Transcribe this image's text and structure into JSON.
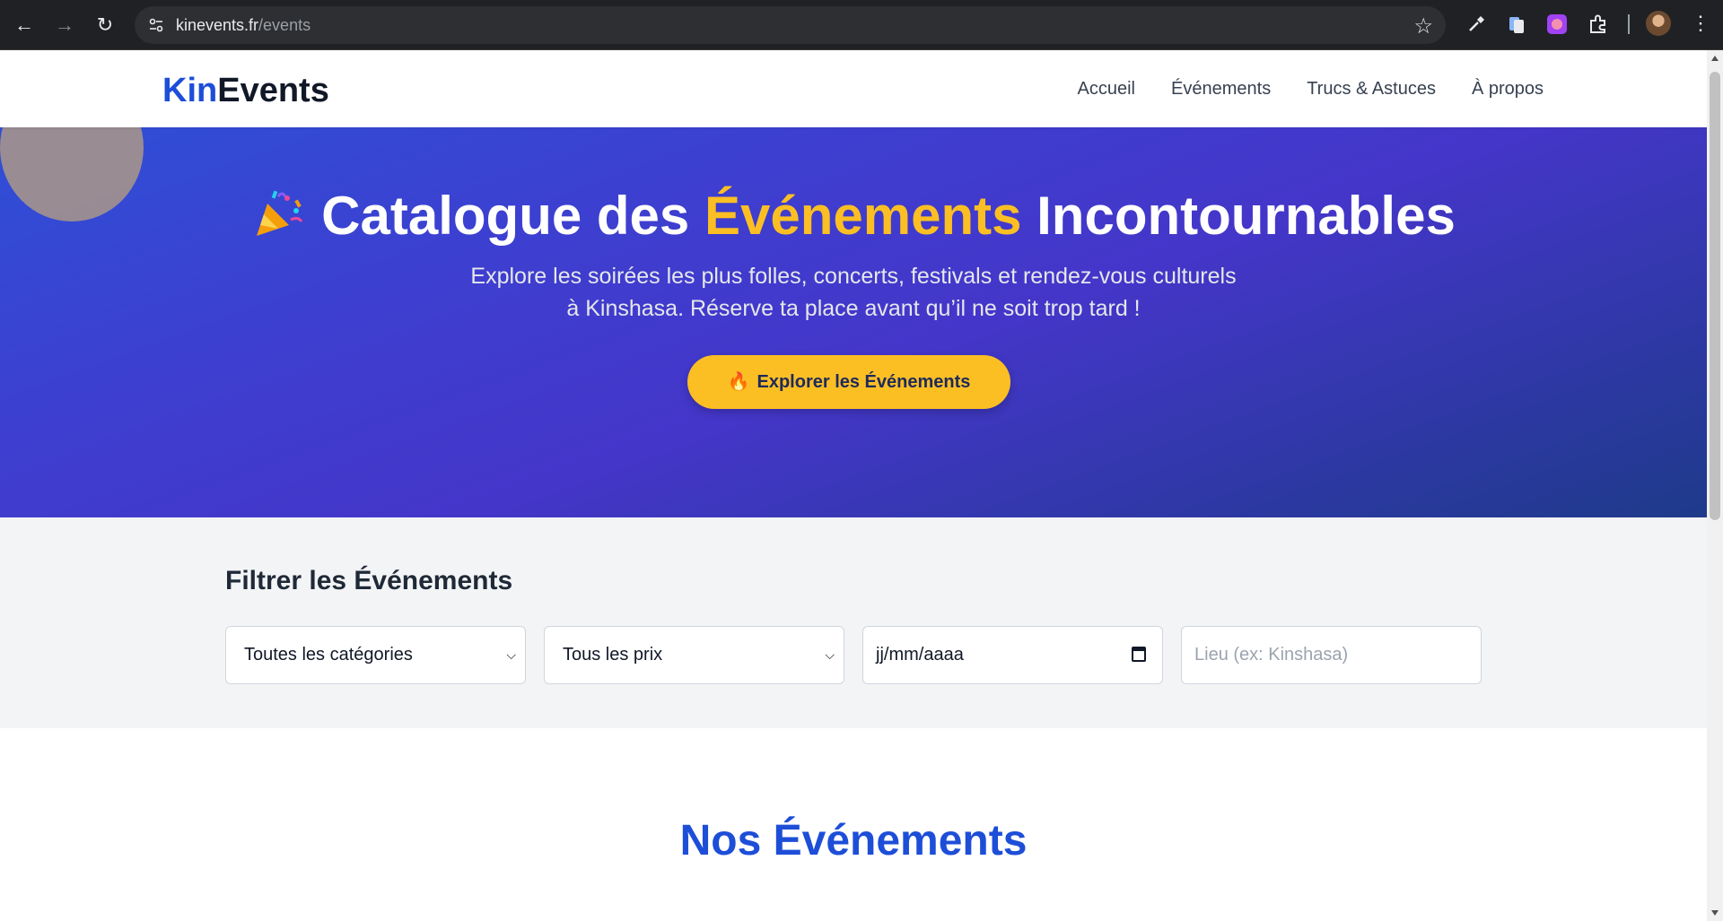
{
  "browser": {
    "url_host": "kinevents.fr",
    "url_path": "/events"
  },
  "header": {
    "logo_part1": "Kin",
    "logo_part2": "Events",
    "nav": [
      "Accueil",
      "Événements",
      "Trucs & Astuces",
      "À propos"
    ]
  },
  "hero": {
    "title_part1": "Catalogue des ",
    "title_accent": "Événements",
    "title_part2": " Incontournables",
    "subtitle_line1": "Explore les soirées les plus folles, concerts, festivals et rendez-vous culturels",
    "subtitle_line2": "à Kinshasa. Réserve ta place avant qu’il ne soit trop tard !",
    "cta_label": "Explorer les Événements",
    "colors": {
      "accent": "#fbbf24",
      "gradient_start": "#2f4fd6",
      "gradient_end": "#1e3a8a"
    }
  },
  "filters": {
    "title": "Filtrer les Événements",
    "category_value": "Toutes les catégories",
    "price_value": "Tous les prix",
    "date_value": "jj/mm/aaaa",
    "location_placeholder": "Lieu (ex: Kinshasa)"
  },
  "events": {
    "title": "Nos Événements"
  }
}
